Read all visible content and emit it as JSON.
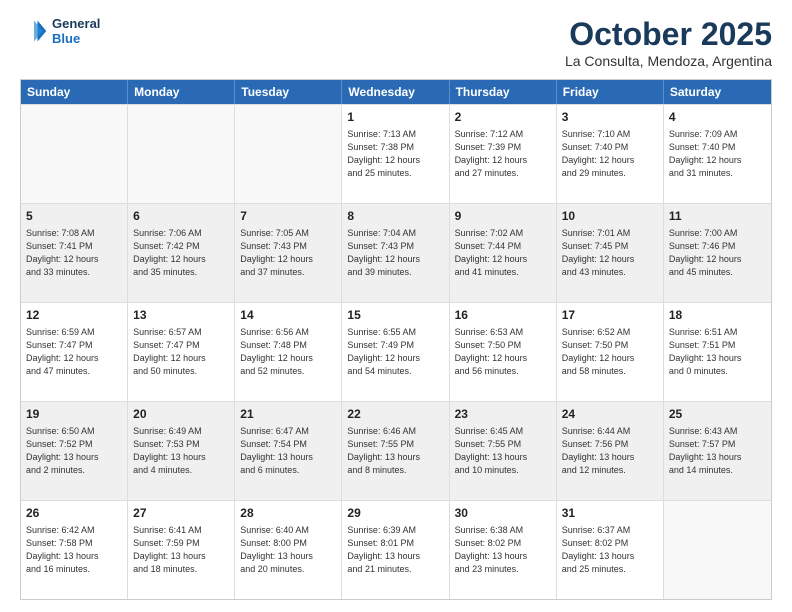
{
  "logo": {
    "line1": "General",
    "line2": "Blue"
  },
  "header": {
    "title": "October 2025",
    "subtitle": "La Consulta, Mendoza, Argentina"
  },
  "days": [
    "Sunday",
    "Monday",
    "Tuesday",
    "Wednesday",
    "Thursday",
    "Friday",
    "Saturday"
  ],
  "rows": [
    [
      {
        "day": "",
        "empty": true
      },
      {
        "day": "",
        "empty": true
      },
      {
        "day": "",
        "empty": true
      },
      {
        "day": "1",
        "lines": [
          "Sunrise: 7:13 AM",
          "Sunset: 7:38 PM",
          "Daylight: 12 hours",
          "and 25 minutes."
        ]
      },
      {
        "day": "2",
        "lines": [
          "Sunrise: 7:12 AM",
          "Sunset: 7:39 PM",
          "Daylight: 12 hours",
          "and 27 minutes."
        ]
      },
      {
        "day": "3",
        "lines": [
          "Sunrise: 7:10 AM",
          "Sunset: 7:40 PM",
          "Daylight: 12 hours",
          "and 29 minutes."
        ]
      },
      {
        "day": "4",
        "lines": [
          "Sunrise: 7:09 AM",
          "Sunset: 7:40 PM",
          "Daylight: 12 hours",
          "and 31 minutes."
        ]
      }
    ],
    [
      {
        "day": "5",
        "shaded": true,
        "lines": [
          "Sunrise: 7:08 AM",
          "Sunset: 7:41 PM",
          "Daylight: 12 hours",
          "and 33 minutes."
        ]
      },
      {
        "day": "6",
        "shaded": true,
        "lines": [
          "Sunrise: 7:06 AM",
          "Sunset: 7:42 PM",
          "Daylight: 12 hours",
          "and 35 minutes."
        ]
      },
      {
        "day": "7",
        "shaded": true,
        "lines": [
          "Sunrise: 7:05 AM",
          "Sunset: 7:43 PM",
          "Daylight: 12 hours",
          "and 37 minutes."
        ]
      },
      {
        "day": "8",
        "shaded": true,
        "lines": [
          "Sunrise: 7:04 AM",
          "Sunset: 7:43 PM",
          "Daylight: 12 hours",
          "and 39 minutes."
        ]
      },
      {
        "day": "9",
        "shaded": true,
        "lines": [
          "Sunrise: 7:02 AM",
          "Sunset: 7:44 PM",
          "Daylight: 12 hours",
          "and 41 minutes."
        ]
      },
      {
        "day": "10",
        "shaded": true,
        "lines": [
          "Sunrise: 7:01 AM",
          "Sunset: 7:45 PM",
          "Daylight: 12 hours",
          "and 43 minutes."
        ]
      },
      {
        "day": "11",
        "shaded": true,
        "lines": [
          "Sunrise: 7:00 AM",
          "Sunset: 7:46 PM",
          "Daylight: 12 hours",
          "and 45 minutes."
        ]
      }
    ],
    [
      {
        "day": "12",
        "lines": [
          "Sunrise: 6:59 AM",
          "Sunset: 7:47 PM",
          "Daylight: 12 hours",
          "and 47 minutes."
        ]
      },
      {
        "day": "13",
        "lines": [
          "Sunrise: 6:57 AM",
          "Sunset: 7:47 PM",
          "Daylight: 12 hours",
          "and 50 minutes."
        ]
      },
      {
        "day": "14",
        "lines": [
          "Sunrise: 6:56 AM",
          "Sunset: 7:48 PM",
          "Daylight: 12 hours",
          "and 52 minutes."
        ]
      },
      {
        "day": "15",
        "lines": [
          "Sunrise: 6:55 AM",
          "Sunset: 7:49 PM",
          "Daylight: 12 hours",
          "and 54 minutes."
        ]
      },
      {
        "day": "16",
        "lines": [
          "Sunrise: 6:53 AM",
          "Sunset: 7:50 PM",
          "Daylight: 12 hours",
          "and 56 minutes."
        ]
      },
      {
        "day": "17",
        "lines": [
          "Sunrise: 6:52 AM",
          "Sunset: 7:50 PM",
          "Daylight: 12 hours",
          "and 58 minutes."
        ]
      },
      {
        "day": "18",
        "lines": [
          "Sunrise: 6:51 AM",
          "Sunset: 7:51 PM",
          "Daylight: 13 hours",
          "and 0 minutes."
        ]
      }
    ],
    [
      {
        "day": "19",
        "shaded": true,
        "lines": [
          "Sunrise: 6:50 AM",
          "Sunset: 7:52 PM",
          "Daylight: 13 hours",
          "and 2 minutes."
        ]
      },
      {
        "day": "20",
        "shaded": true,
        "lines": [
          "Sunrise: 6:49 AM",
          "Sunset: 7:53 PM",
          "Daylight: 13 hours",
          "and 4 minutes."
        ]
      },
      {
        "day": "21",
        "shaded": true,
        "lines": [
          "Sunrise: 6:47 AM",
          "Sunset: 7:54 PM",
          "Daylight: 13 hours",
          "and 6 minutes."
        ]
      },
      {
        "day": "22",
        "shaded": true,
        "lines": [
          "Sunrise: 6:46 AM",
          "Sunset: 7:55 PM",
          "Daylight: 13 hours",
          "and 8 minutes."
        ]
      },
      {
        "day": "23",
        "shaded": true,
        "lines": [
          "Sunrise: 6:45 AM",
          "Sunset: 7:55 PM",
          "Daylight: 13 hours",
          "and 10 minutes."
        ]
      },
      {
        "day": "24",
        "shaded": true,
        "lines": [
          "Sunrise: 6:44 AM",
          "Sunset: 7:56 PM",
          "Daylight: 13 hours",
          "and 12 minutes."
        ]
      },
      {
        "day": "25",
        "shaded": true,
        "lines": [
          "Sunrise: 6:43 AM",
          "Sunset: 7:57 PM",
          "Daylight: 13 hours",
          "and 14 minutes."
        ]
      }
    ],
    [
      {
        "day": "26",
        "lines": [
          "Sunrise: 6:42 AM",
          "Sunset: 7:58 PM",
          "Daylight: 13 hours",
          "and 16 minutes."
        ]
      },
      {
        "day": "27",
        "lines": [
          "Sunrise: 6:41 AM",
          "Sunset: 7:59 PM",
          "Daylight: 13 hours",
          "and 18 minutes."
        ]
      },
      {
        "day": "28",
        "lines": [
          "Sunrise: 6:40 AM",
          "Sunset: 8:00 PM",
          "Daylight: 13 hours",
          "and 20 minutes."
        ]
      },
      {
        "day": "29",
        "lines": [
          "Sunrise: 6:39 AM",
          "Sunset: 8:01 PM",
          "Daylight: 13 hours",
          "and 21 minutes."
        ]
      },
      {
        "day": "30",
        "lines": [
          "Sunrise: 6:38 AM",
          "Sunset: 8:02 PM",
          "Daylight: 13 hours",
          "and 23 minutes."
        ]
      },
      {
        "day": "31",
        "lines": [
          "Sunrise: 6:37 AM",
          "Sunset: 8:02 PM",
          "Daylight: 13 hours",
          "and 25 minutes."
        ]
      },
      {
        "day": "",
        "empty": true
      }
    ]
  ]
}
